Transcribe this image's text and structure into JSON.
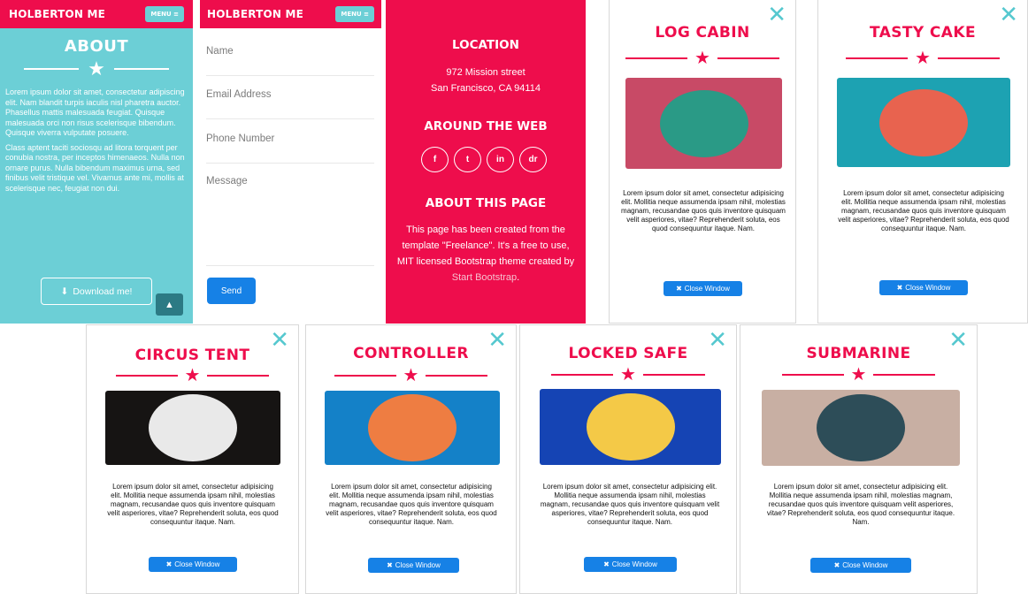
{
  "about_panel": {
    "brand": "HOLBERTON ME",
    "menu": "MENU ≡",
    "title": "ABOUT",
    "paragraph1": "Lorem ipsum dolor sit amet, consectetur adipiscing elit. Nam blandit turpis iaculis nisl pharetra auctor. Phasellus mattis malesuada feugiat. Quisque malesuada orci non risus scelerisque bibendum. Quisque viverra vulputate posuere.",
    "paragraph2": "Class aptent taciti sociosqu ad litora torquent per conubia nostra, per inceptos himenaeos. Nulla non ornare purus. Nulla bibendum maximus urna, sed finibus velit tristique vel. Vivamus ante mi, mollis at scelerisque nec, feugiat non dui.",
    "download_label": "Download me!"
  },
  "form_panel": {
    "brand": "HOLBERTON ME",
    "menu": "MENU ≡",
    "name_placeholder": "Name",
    "email_placeholder": "Email Address",
    "phone_placeholder": "Phone Number",
    "message_placeholder": "Message",
    "send_label": "Send"
  },
  "footer_panel": {
    "location_title": "LOCATION",
    "address_line1": "972 Mission street",
    "address_line2": "San Francisco, CA 94114",
    "web_title": "AROUND THE WEB",
    "social": [
      "f",
      "t",
      "in",
      "dr"
    ],
    "about_title": "ABOUT THIS PAGE",
    "about_text": "This page has been created from the template \"Freelance\". It's a free to use, MIT licensed Bootstrap theme created by",
    "about_link": "Start Bootstrap",
    "about_end": "."
  },
  "modal_text": "Lorem ipsum dolor sit amet, consectetur adipisicing elit. Mollitia neque assumenda ipsam nihil, molestias magnam, recusandae quos quis inventore quisquam velit asperiores, vitae? Reprehenderit soluta, eos quod consequuntur itaque. Nam.",
  "modals": [
    {
      "title": "LOG CABIN",
      "close": "Close Window",
      "bg": "#c84a66",
      "disc": "#2a9a86"
    },
    {
      "title": "TASTY CAKE",
      "close": "Close Window",
      "bg": "#1da2b2",
      "disc": "#e8634f"
    },
    {
      "title": "CIRCUS TENT",
      "close": "Close Window",
      "bg": "#161413",
      "disc": "#e9e9e9"
    },
    {
      "title": "CONTROLLER",
      "close": "Close Window",
      "bg": "#1481c8",
      "disc": "#ee7d42"
    },
    {
      "title": "LOCKED SAFE",
      "close": "Close Window",
      "bg": "#1544b4",
      "disc": "#f4c947"
    },
    {
      "title": "SUBMARINE",
      "close": "Close Window",
      "bg": "#c8afa3",
      "disc": "#2d4d58"
    }
  ]
}
